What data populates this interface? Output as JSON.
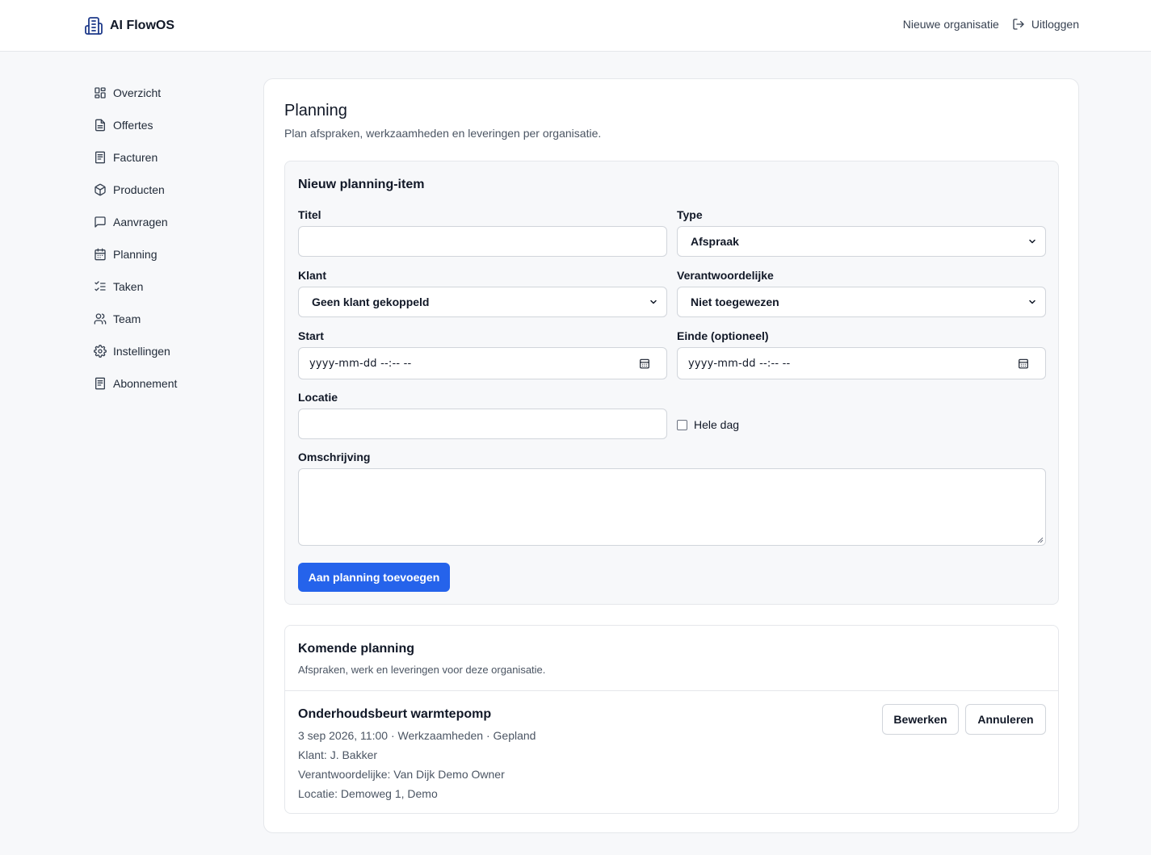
{
  "header": {
    "app_name": "AI FlowOS",
    "new_org_label": "Nieuwe organisatie",
    "logout_label": "Uitloggen"
  },
  "sidebar": {
    "items": [
      {
        "label": "Overzicht",
        "icon": "grid-icon"
      },
      {
        "label": "Offertes",
        "icon": "file-text-icon"
      },
      {
        "label": "Facturen",
        "icon": "receipt-icon"
      },
      {
        "label": "Producten",
        "icon": "package-icon"
      },
      {
        "label": "Aanvragen",
        "icon": "message-square-icon"
      },
      {
        "label": "Planning",
        "icon": "calendar-icon"
      },
      {
        "label": "Taken",
        "icon": "list-checks-icon"
      },
      {
        "label": "Team",
        "icon": "users-icon"
      },
      {
        "label": "Instellingen",
        "icon": "gear-icon"
      },
      {
        "label": "Abonnement",
        "icon": "receipt-icon"
      }
    ]
  },
  "page": {
    "title": "Planning",
    "subtitle": "Plan afspraken, werkzaamheden en leveringen per organisatie."
  },
  "form": {
    "title": "Nieuw planning-item",
    "titel_label": "Titel",
    "titel_value": "",
    "type_label": "Type",
    "type_value": "Afspraak",
    "klant_label": "Klant",
    "klant_value": "Geen klant gekoppeld",
    "verantwoordelijke_label": "Verantwoordelijke",
    "verantwoordelijke_value": "Niet toegewezen",
    "start_label": "Start",
    "start_placeholder": "yyyy-mm-dd --:-- --",
    "einde_label": "Einde (optioneel)",
    "einde_placeholder": "yyyy-mm-dd --:-- --",
    "locatie_label": "Locatie",
    "locatie_value": "",
    "hele_dag_label": "Hele dag",
    "hele_dag_checked": false,
    "omschrijving_label": "Omschrijving",
    "omschrijving_value": "",
    "submit_label": "Aan planning toevoegen"
  },
  "upcoming": {
    "title": "Komende planning",
    "subtitle": "Afspraken, werk en leveringen voor deze organisatie.",
    "items": [
      {
        "title": "Onderhoudsbeurt warmtepomp",
        "meta": "3 sep 2026, 11:00 · Werkzaamheden · Gepland",
        "klant": "Klant: J. Bakker",
        "verantwoordelijke": "Verantwoordelijke: Van Dijk Demo Owner",
        "locatie": "Locatie: Demoweg 1, Demo",
        "edit_label": "Bewerken",
        "cancel_label": "Annuleren"
      }
    ]
  },
  "colors": {
    "primary": "#2563eb",
    "brand_icon": "#1e3a8a",
    "border": "#e5e7eb",
    "page_bg": "#f7f8fa"
  }
}
